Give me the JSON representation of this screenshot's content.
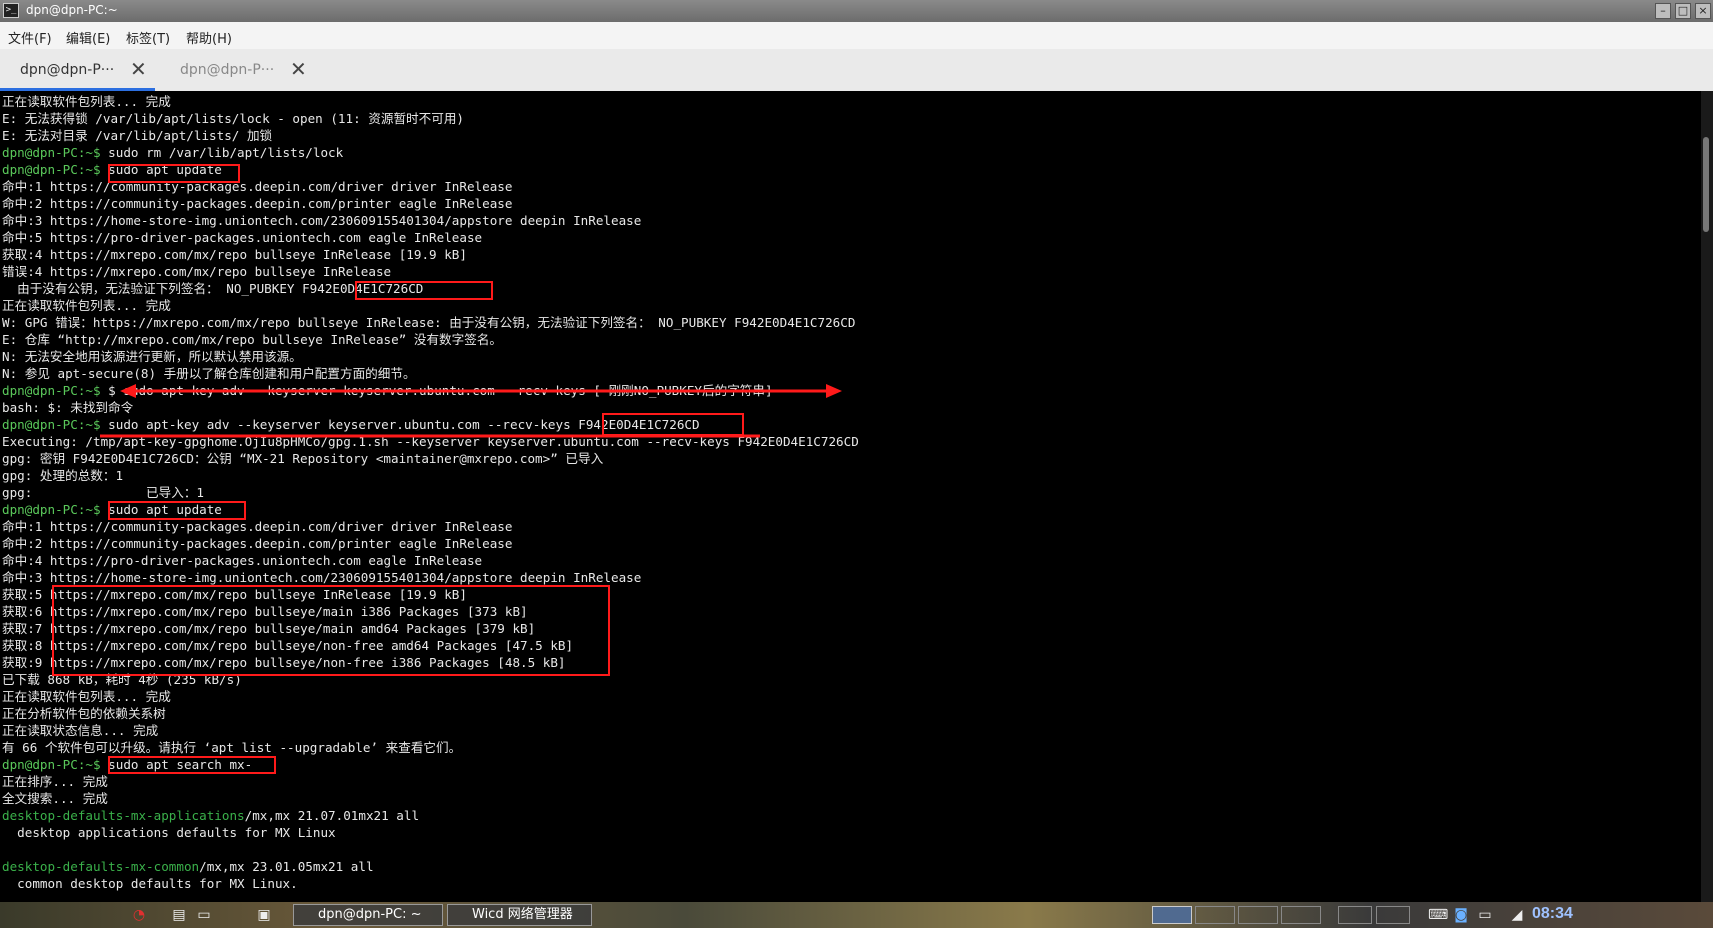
{
  "window": {
    "title": "dpn@dpn-PC:~"
  },
  "menu": {
    "file": "文件(F)",
    "edit": "编辑(E)",
    "tags": "标签(T)",
    "help": "帮助(H)"
  },
  "tabs": [
    {
      "label": "dpn@dpn-P···"
    },
    {
      "label": "dpn@dpn-P···"
    }
  ],
  "terminal": {
    "lines": [
      {
        "text": "正在读取软件包列表... 完成"
      },
      {
        "text": "E: 无法获得锁 /var/lib/apt/lists/lock - open (11: 资源暂时不可用)"
      },
      {
        "text": "E: 无法对目录 /var/lib/apt/lists/ 加锁"
      },
      {
        "prompt": "dpn@dpn-PC:~$",
        "text": " sudo rm /var/lib/apt/lists/lock"
      },
      {
        "prompt": "dpn@dpn-PC:~$",
        "text": " sudo apt update"
      },
      {
        "text": "命中:1 https://community-packages.deepin.com/driver driver InRelease"
      },
      {
        "text": "命中:2 https://community-packages.deepin.com/printer eagle InRelease"
      },
      {
        "text": "命中:3 https://home-store-img.uniontech.com/230609155401304/appstore deepin InRelease"
      },
      {
        "text": "命中:5 https://pro-driver-packages.uniontech.com eagle InRelease"
      },
      {
        "text": "获取:4 https://mxrepo.com/mx/repo bullseye InRelease [19.9 kB]"
      },
      {
        "text": "错误:4 https://mxrepo.com/mx/repo bullseye InRelease"
      },
      {
        "text": "  由于没有公钥，无法验证下列签名： NO_PUBKEY F942E0D4E1C726CD"
      },
      {
        "text": "正在读取软件包列表... 完成"
      },
      {
        "text": "W: GPG 错误：https://mxrepo.com/mx/repo bullseye InRelease: 由于没有公钥，无法验证下列签名： NO_PUBKEY F942E0D4E1C726CD"
      },
      {
        "text": "E: 仓库 “http://mxrepo.com/mx/repo bullseye InRelease” 没有数字签名。"
      },
      {
        "text": "N: 无法安全地用该源进行更新，所以默认禁用该源。"
      },
      {
        "text": "N: 参见 apt-secure(8) 手册以了解仓库创建和用户配置方面的细节。"
      },
      {
        "prompt": "dpn@dpn-PC:~$",
        "text": " $ sudo apt-key adv --keyserver keyserver.ubuntu.com --recv-keys [ 刚刚NO_PUBKEY后的字符串]"
      },
      {
        "text": "bash: $: 未找到命令"
      },
      {
        "prompt": "dpn@dpn-PC:~$",
        "text": " sudo apt-key adv --keyserver keyserver.ubuntu.com --recv-keys F942E0D4E1C726CD"
      },
      {
        "text": "Executing: /tmp/apt-key-gpghome.OjIu8pHMCo/gpg.1.sh --keyserver keyserver.ubuntu.com --recv-keys F942E0D4E1C726CD"
      },
      {
        "text": "gpg: 密钥 F942E0D4E1C726CD：公钥 “MX-21 Repository <maintainer@mxrepo.com>” 已导入"
      },
      {
        "text": "gpg: 处理的总数：1"
      },
      {
        "text": "gpg:               已导入：1"
      },
      {
        "prompt": "dpn@dpn-PC:~$",
        "text": " sudo apt update"
      },
      {
        "text": "命中:1 https://community-packages.deepin.com/driver driver InRelease"
      },
      {
        "text": "命中:2 https://community-packages.deepin.com/printer eagle InRelease"
      },
      {
        "text": "命中:4 https://pro-driver-packages.uniontech.com eagle InRelease"
      },
      {
        "text": "命中:3 https://home-store-img.uniontech.com/230609155401304/appstore deepin InRelease"
      },
      {
        "text": "获取:5 https://mxrepo.com/mx/repo bullseye InRelease [19.9 kB]"
      },
      {
        "text": "获取:6 https://mxrepo.com/mx/repo bullseye/main i386 Packages [373 kB]"
      },
      {
        "text": "获取:7 https://mxrepo.com/mx/repo bullseye/main amd64 Packages [379 kB]"
      },
      {
        "text": "获取:8 https://mxrepo.com/mx/repo bullseye/non-free amd64 Packages [47.5 kB]"
      },
      {
        "text": "获取:9 https://mxrepo.com/mx/repo bullseye/non-free i386 Packages [48.5 kB]"
      },
      {
        "text": "已下载 868 kB，耗时 4秒 (235 kB/s)"
      },
      {
        "text": "正在读取软件包列表... 完成"
      },
      {
        "text": "正在分析软件包的依赖关系树"
      },
      {
        "text": "正在读取状态信息... 完成"
      },
      {
        "text": "有 66 个软件包可以升级。请执行 ‘apt list --upgradable’ 来查看它们。"
      },
      {
        "prompt": "dpn@dpn-PC:~$",
        "text": " sudo apt search mx-"
      },
      {
        "text": "正在排序... 完成"
      },
      {
        "text": "全文搜索... 完成"
      },
      {
        "pkg": "desktop-defaults-mx-applications",
        "text": "/mx,mx 21.07.01mx21 all"
      },
      {
        "text": "  desktop applications defaults for MX Linux"
      },
      {
        "text": ""
      },
      {
        "pkg": "desktop-defaults-mx-common",
        "text": "/mx,mx 23.01.05mx21 all"
      },
      {
        "text": "  common desktop defaults for MX Linux."
      }
    ]
  },
  "taskbar": {
    "items": [
      {
        "label": "dpn@dpn-PC: ~"
      },
      {
        "label": "Wicd 网络管理器"
      }
    ],
    "clock": "08:34"
  },
  "colors": {
    "prompt": "#5ac85a",
    "annotation": "#ff1a1a",
    "terminal_bg": "#000000"
  }
}
